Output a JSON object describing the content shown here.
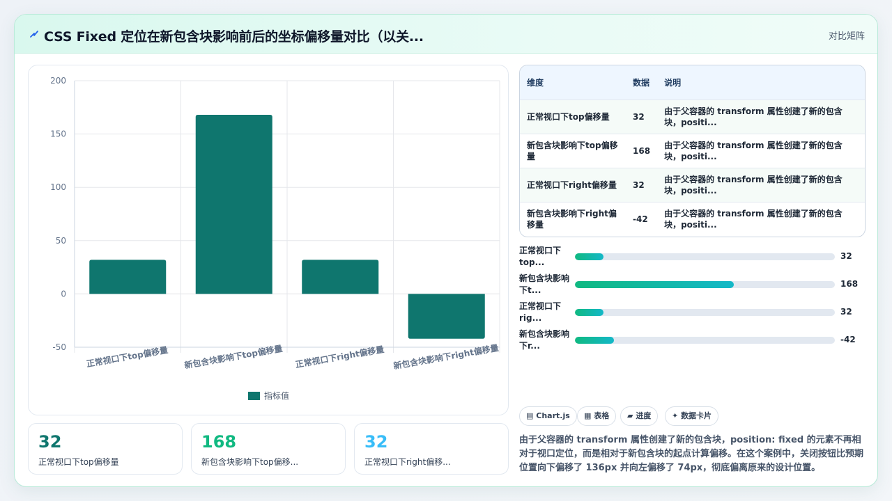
{
  "header": {
    "title": "CSS Fixed 定位在新包含块影响前后的坐标偏移量对比（以关...",
    "mode_label": "对比矩阵",
    "icon": "lightning-icon"
  },
  "chart_data": {
    "type": "bar",
    "categories": [
      "正常视口下top偏移量",
      "新包含块影响下top偏移量",
      "正常视口下right偏移量",
      "新包含块影响下right偏移量"
    ],
    "series": [
      {
        "name": "指标值",
        "values": [
          32,
          168,
          32,
          -42
        ]
      }
    ],
    "yticks": [
      "200",
      "150",
      "100",
      "50",
      "0",
      "-50"
    ],
    "ylim": [
      -50,
      200
    ],
    "grid": true,
    "legend_position": "bottom",
    "color": "#0f766e"
  },
  "kpis": [
    {
      "value": "32",
      "label": "正常视口下top偏移量",
      "color": "#0f766e"
    },
    {
      "value": "168",
      "label": "新包含块影响下top偏移...",
      "color": "#10b981"
    },
    {
      "value": "32",
      "label": "正常视口下right偏移...",
      "color": "#38bdf8"
    }
  ],
  "table": {
    "headers": [
      "维度",
      "数据",
      "说明"
    ],
    "rows": [
      [
        "正常视口下top偏移量",
        "32",
        "由于父容器的 transform 属性创建了新的包含块，positi..."
      ],
      [
        "新包含块影响下top偏移量",
        "168",
        "由于父容器的 transform 属性创建了新的包含块，positi..."
      ],
      [
        "正常视口下right偏移量",
        "32",
        "由于父容器的 transform 属性创建了新的包含块，positi..."
      ],
      [
        "新包含块影响下right偏移量",
        "-42",
        "由于父容器的 transform 属性创建了新的包含块，positi..."
      ]
    ]
  },
  "progress": [
    {
      "label": "正常视口下top...",
      "value": "32",
      "fraction": 0.11
    },
    {
      "label": "新包含块影响下t...",
      "value": "168",
      "fraction": 0.61
    },
    {
      "label": "正常视口下rig...",
      "value": "32",
      "fraction": 0.11
    },
    {
      "label": "新包含块影响下r...",
      "value": "-42",
      "fraction": 0.15
    }
  ],
  "chips": [
    {
      "icon": "chart-icon",
      "label": "Chart.js"
    },
    {
      "icon": "table-icon",
      "label": "表格"
    },
    {
      "icon": "progress-icon",
      "label": "进度"
    },
    {
      "icon": "sparkle-icon",
      "label": "数据卡片"
    }
  ],
  "summary": "由于父容器的 transform 属性创建了新的包含块，position: fixed 的元素不再相对于视口定位，而是相对于新包含块的起点计算偏移。在这个案例中，关闭按钮比预期位置向下偏移了 136px 并向左偏移了 74px，彻底偏离原来的设计位置。"
}
